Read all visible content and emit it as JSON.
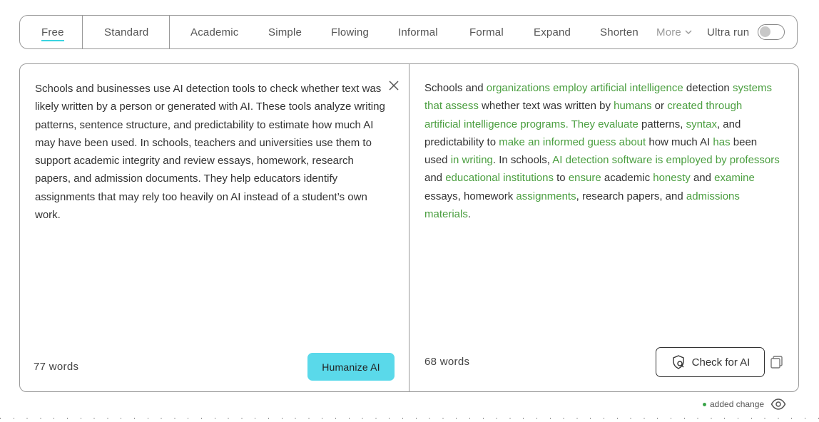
{
  "modes": {
    "free": "Free",
    "standard": "Standard",
    "academic": "Academic",
    "simple": "Simple",
    "flowing": "Flowing",
    "informal": "Informal",
    "formal": "Formal",
    "expand": "Expand",
    "shorten": "Shorten",
    "more": "More",
    "ultra_run": "Ultra run",
    "ultra_run_enabled": false
  },
  "input": {
    "text": "Schools and businesses use AI detection tools to check whether text was likely written by a person or generated with AI. These tools analyze writing patterns, sentence structure, and predictability to estimate how much AI may have been used. In schools, teachers and universities use them to support academic integrity and review essays, homework, research papers, and admission documents. They help educators identify assignments that may rely too heavily on AI instead of a student’s own work.",
    "word_count": "77 words",
    "humanize_label": "Humanize AI"
  },
  "output": {
    "segments": [
      {
        "text": "Schools and ",
        "changed": false
      },
      {
        "text": "organizations employ artificial intelligence",
        "changed": true
      },
      {
        "text": " detection ",
        "changed": false
      },
      {
        "text": "systems that assess",
        "changed": true
      },
      {
        "text": " whether text was written by ",
        "changed": false
      },
      {
        "text": "humans",
        "changed": true
      },
      {
        "text": " or ",
        "changed": false
      },
      {
        "text": "created through artificial intelligence programs. They evaluate",
        "changed": true
      },
      {
        "text": " patterns, ",
        "changed": false
      },
      {
        "text": "syntax",
        "changed": true
      },
      {
        "text": ", and predictability to ",
        "changed": false
      },
      {
        "text": "make an informed guess about",
        "changed": true
      },
      {
        "text": " how much AI ",
        "changed": false
      },
      {
        "text": "has",
        "changed": true
      },
      {
        "text": " been used ",
        "changed": false
      },
      {
        "text": "in writing",
        "changed": true
      },
      {
        "text": ". In schools, ",
        "changed": false
      },
      {
        "text": "AI detection software is employed by professors",
        "changed": true
      },
      {
        "text": " and ",
        "changed": false
      },
      {
        "text": "educational institutions",
        "changed": true
      },
      {
        "text": " to ",
        "changed": false
      },
      {
        "text": "ensure",
        "changed": true
      },
      {
        "text": " academic ",
        "changed": false
      },
      {
        "text": "honesty",
        "changed": true
      },
      {
        "text": " and ",
        "changed": false
      },
      {
        "text": "examine",
        "changed": true
      },
      {
        "text": " essays, homework ",
        "changed": false
      },
      {
        "text": "assignments",
        "changed": true
      },
      {
        "text": ", research papers, and ",
        "changed": false
      },
      {
        "text": "admissions materials",
        "changed": true
      },
      {
        "text": ".",
        "changed": false
      }
    ],
    "word_count": "68 words",
    "check_label": "Check for AI"
  },
  "legend": {
    "added_change": "added change"
  },
  "colors": {
    "accent": "#5ad9ea",
    "change": "#4a9e3f"
  }
}
